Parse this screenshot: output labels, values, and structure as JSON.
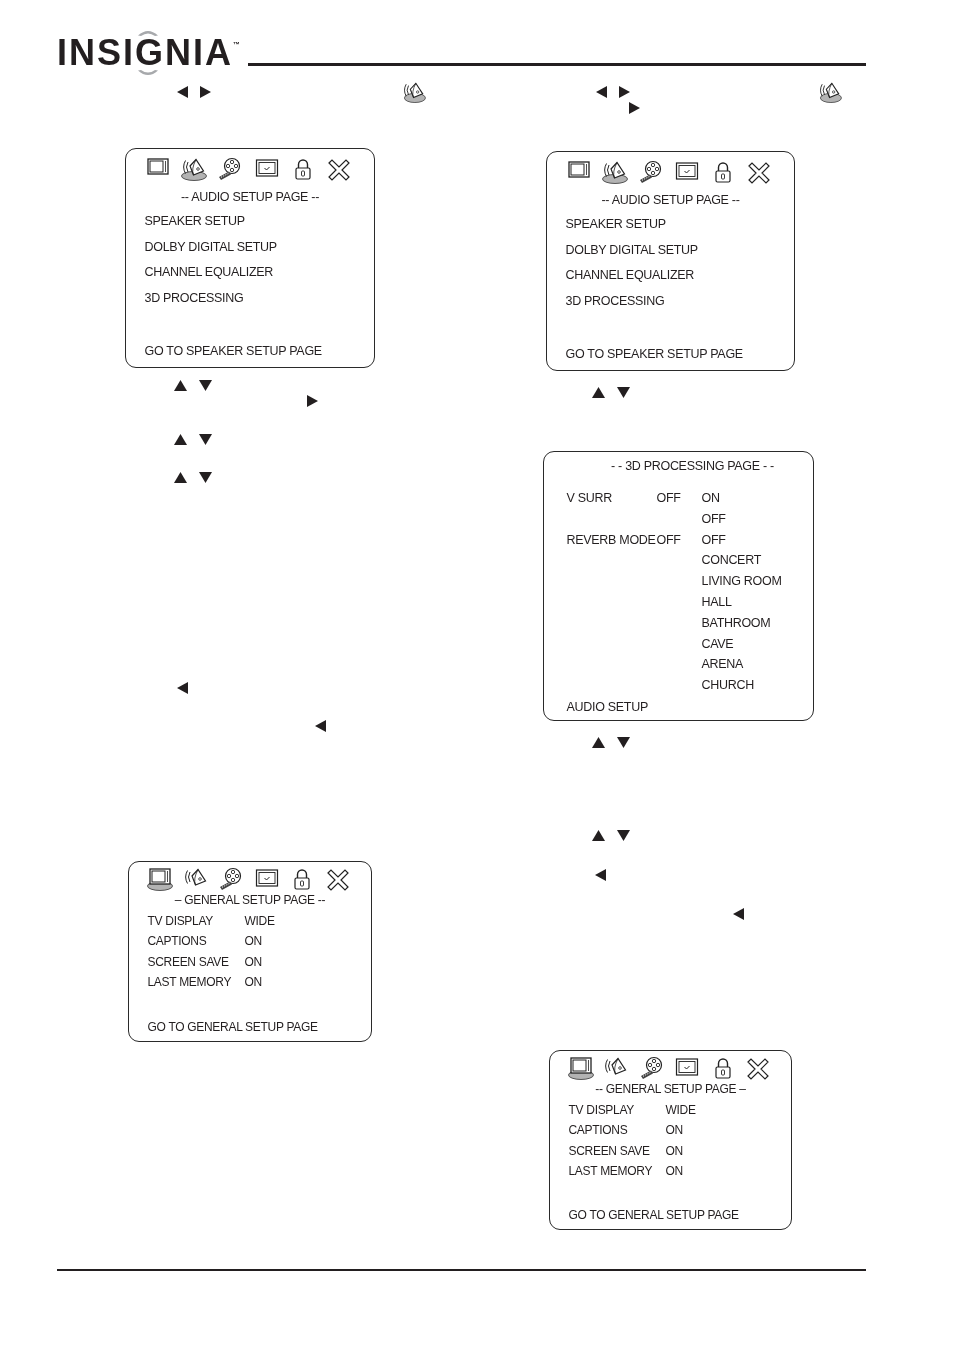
{
  "header": {
    "logo": "INSIGNIA",
    "trademark": "™"
  },
  "columns": [
    {
      "screens": [
        {
          "kind": "menu",
          "tabs": [
            {
              "selected": false
            },
            {
              "selected": true
            },
            {
              "selected": false
            },
            {
              "selected": false
            },
            {
              "selected": false
            },
            {
              "selected": false
            }
          ],
          "title": "-- AUDIO SETUP PAGE --",
          "items": [
            "SPEAKER SETUP",
            "DOLBY DIGITAL SETUP",
            "CHANNEL EQUALIZER",
            "3D PROCESSING"
          ],
          "footer": "GO TO SPEAKER SETUP PAGE"
        },
        {
          "kind": "settings",
          "tabs": [
            {
              "selected": true
            },
            {
              "selected": false
            },
            {
              "selected": false
            },
            {
              "selected": false
            },
            {
              "selected": false
            },
            {
              "selected": false
            }
          ],
          "title": "– GENERAL SETUP PAGE --",
          "rows": [
            {
              "label": "TV DISPLAY",
              "value": "WIDE"
            },
            {
              "label": "CAPTIONS",
              "value": "ON"
            },
            {
              "label": "SCREEN SAVE",
              "value": "ON"
            },
            {
              "label": "LAST MEMORY",
              "value": "ON"
            }
          ],
          "footer": "GO TO GENERAL SETUP PAGE"
        }
      ]
    },
    {
      "screens": [
        {
          "kind": "menu",
          "tabs": [
            {
              "selected": false
            },
            {
              "selected": true
            },
            {
              "selected": false
            },
            {
              "selected": false
            },
            {
              "selected": false
            },
            {
              "selected": false
            }
          ],
          "title": "-- AUDIO SETUP PAGE --",
          "items": [
            "SPEAKER SETUP",
            "DOLBY DIGITAL SETUP",
            "CHANNEL EQUALIZER",
            "3D PROCESSING"
          ],
          "footer": "GO TO SPEAKER SETUP PAGE"
        },
        {
          "kind": "options",
          "title": "- - 3D PROCESSING PAGE - -",
          "rows": [
            {
              "label": "V SURR",
              "value": "OFF",
              "options": [
                "ON",
                "OFF"
              ]
            },
            {
              "label": "REVERB MODE",
              "value": "OFF",
              "options": [
                "OFF",
                "CONCERT",
                "LIVING ROOM",
                "HALL",
                "BATHROOM",
                "CAVE",
                "ARENA",
                "CHURCH"
              ]
            }
          ],
          "footer": "AUDIO SETUP"
        },
        {
          "kind": "settings",
          "tabs": [
            {
              "selected": true
            },
            {
              "selected": false
            },
            {
              "selected": false
            },
            {
              "selected": false
            },
            {
              "selected": false
            },
            {
              "selected": false
            }
          ],
          "title": "-- GENERAL SETUP PAGE –",
          "rows": [
            {
              "label": "TV DISPLAY",
              "value": "WIDE"
            },
            {
              "label": "CAPTIONS",
              "value": "ON"
            },
            {
              "label": "SCREEN SAVE",
              "value": "ON"
            },
            {
              "label": "LAST MEMORY",
              "value": "ON"
            }
          ],
          "footer": "GO TO GENERAL SETUP PAGE"
        }
      ]
    }
  ]
}
